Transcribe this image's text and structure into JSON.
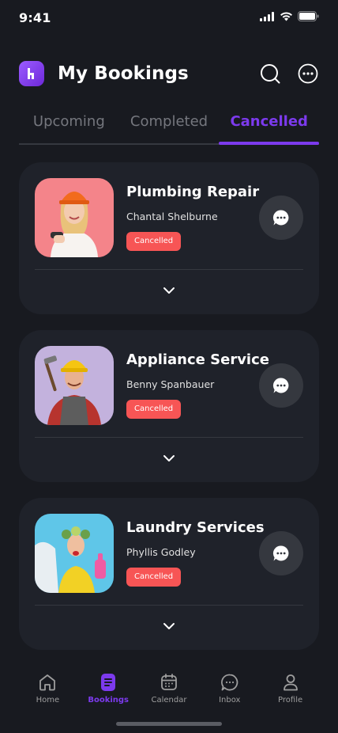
{
  "status_bar": {
    "time": "9:41"
  },
  "header": {
    "title": "My Bookings"
  },
  "tabs": [
    {
      "label": "Upcoming",
      "active": false
    },
    {
      "label": "Completed",
      "active": false
    },
    {
      "label": "Cancelled",
      "active": true
    }
  ],
  "bookings": [
    {
      "service": "Plumbing Repair",
      "provider": "Chantal Shelburne",
      "status": "Cancelled"
    },
    {
      "service": "Appliance Service",
      "provider": "Benny Spanbauer",
      "status": "Cancelled"
    },
    {
      "service": "Laundry Services",
      "provider": "Phyllis Godley",
      "status": "Cancelled"
    }
  ],
  "nav": [
    {
      "label": "Home",
      "icon": "home-icon",
      "active": false
    },
    {
      "label": "Bookings",
      "icon": "document-icon",
      "active": true
    },
    {
      "label": "Calendar",
      "icon": "calendar-icon",
      "active": false
    },
    {
      "label": "Inbox",
      "icon": "chat-icon",
      "active": false
    },
    {
      "label": "Profile",
      "icon": "profile-icon",
      "active": false
    }
  ],
  "colors": {
    "background": "#181a20",
    "card": "#1f222a",
    "accent": "#7c3aed",
    "cancelled_badge": "#f75555",
    "muted": "#75777e"
  }
}
